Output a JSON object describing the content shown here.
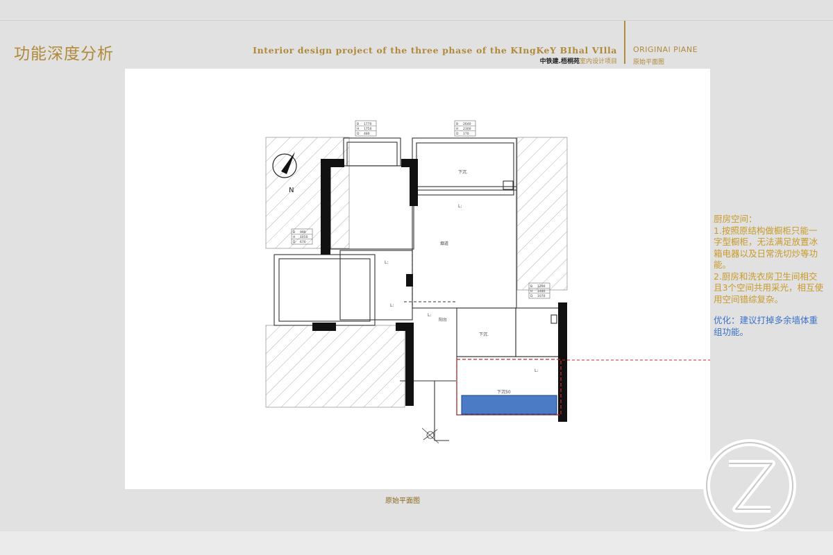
{
  "header": {
    "title": "功能深度分析",
    "project_en": "Interior design project of the three phase of the KIngKeY BIhal VIlla",
    "project_cn_name": "中铁建.梧桐苑",
    "project_cn_sub": "室内设计项目",
    "section_en": "ORIGINAl PlANE",
    "section_cn": "原始平面图"
  },
  "plan": {
    "caption": "原始平面图",
    "north_label": "N",
    "room_labels": {
      "down_1": "下沉.",
      "down_2": "下沉.",
      "down_50": "下沉50",
      "l1": "L:",
      "l2": "L:",
      "l3": "L:",
      "l4": "L:",
      "l5": "L:",
      "balcony": "阳台",
      "flue": "烟道"
    },
    "window_tags": [
      {
        "rows": [
          [
            "B",
            "1770"
          ],
          [
            "H",
            "1750"
          ],
          [
            "D",
            "480"
          ]
        ]
      },
      {
        "rows": [
          [
            "B",
            "2640"
          ],
          [
            "H",
            "2300"
          ],
          [
            "D",
            "170"
          ]
        ]
      },
      {
        "rows": [
          [
            "B",
            "990"
          ],
          [
            "H",
            "1450"
          ],
          [
            "D",
            "670"
          ]
        ]
      },
      {
        "rows": [
          [
            "B",
            "1290"
          ],
          [
            "H",
            "1480"
          ],
          [
            "D",
            "1070"
          ]
        ]
      }
    ],
    "highlight_color": "#d2232a",
    "fill_color": "#4a7bc4"
  },
  "notes": {
    "heading": "厨房空间：",
    "item1": "1.按照原结构做橱柜只能一字型橱柜，无法满足放置冰箱电器以及日常洗切炒等功能。",
    "item2": "2.厨房和洗衣房卫生间相交且3个空间共用采光，相互使用空间错综复杂。",
    "optimization": "优化：建议打掉多余墙体重组功能。"
  },
  "logo": {
    "icon": "circle-z-logo"
  }
}
